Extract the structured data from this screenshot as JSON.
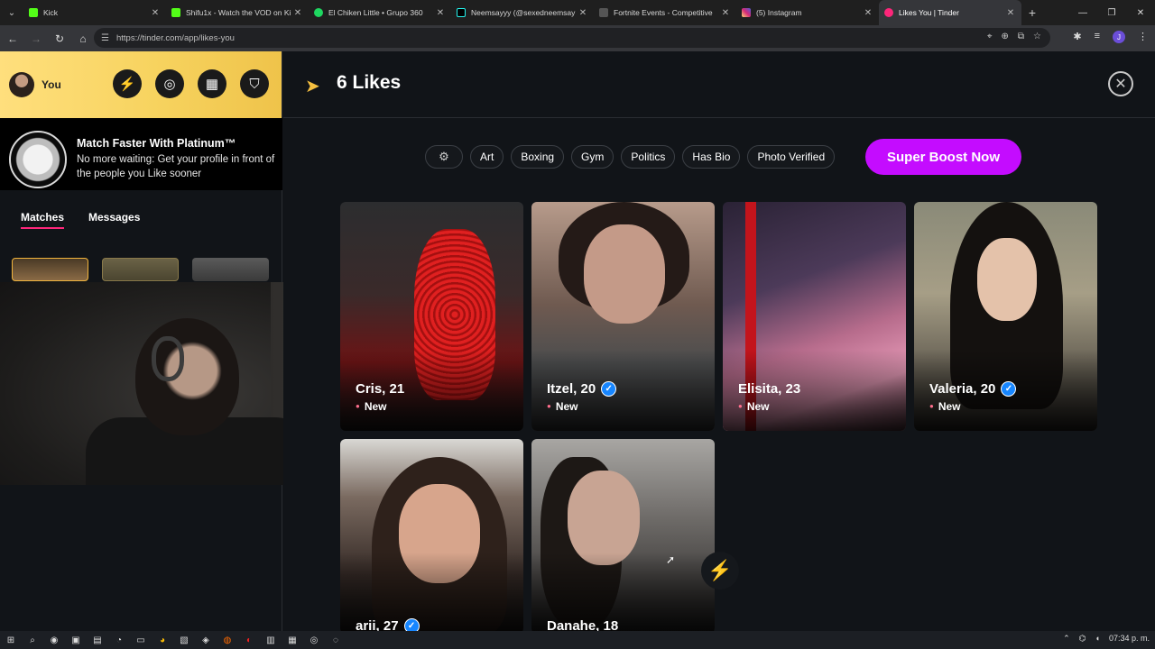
{
  "browser": {
    "tabs": [
      {
        "title": "Kick",
        "color": "#53fc18",
        "active": false
      },
      {
        "title": "Shifu1x - Watch the VOD on Ki",
        "color": "#53fc18",
        "active": false
      },
      {
        "title": "El Chiken Little • Grupo 360",
        "color": "#1ed760",
        "active": false
      },
      {
        "title": "Neemsayyy (@sexedneemsay",
        "color": "#000000",
        "active": false
      },
      {
        "title": "Fortnite Events - Competitive",
        "color": "#2b2b2b",
        "active": false
      },
      {
        "title": "(5) Instagram",
        "color": "#e1306c",
        "active": false
      },
      {
        "title": "Likes You | Tinder",
        "color": "#fd267a",
        "active": true
      }
    ],
    "url": "https://tinder.com/app/likes-you",
    "profile_initial": "J"
  },
  "sidebar": {
    "user_label": "You",
    "promo": {
      "title": "Match Faster With Platinum™",
      "text": "No more waiting: Get your profile in front of the people you Like sooner"
    },
    "tabs": {
      "matches": "Matches",
      "messages": "Messages"
    }
  },
  "main": {
    "likes_title": "6 Likes",
    "filters": [
      "Art",
      "Boxing",
      "Gym",
      "Politics",
      "Has Bio",
      "Photo Verified"
    ],
    "boost_button": "Super Boost Now",
    "profiles": [
      {
        "name": "Cris, 21",
        "verified": false,
        "status": "New"
      },
      {
        "name": "Itzel, 20",
        "verified": true,
        "status": "New"
      },
      {
        "name": "Elisita, 23",
        "verified": false,
        "status": "New"
      },
      {
        "name": "Valeria, 20",
        "verified": true,
        "status": "New"
      },
      {
        "name": "arii, 27",
        "verified": true,
        "status": ""
      },
      {
        "name": "Danahe, 18",
        "verified": false,
        "status": ""
      }
    ]
  },
  "taskbar": {
    "clock": "07:34 p. m."
  },
  "colors": {
    "brand": "#fd267a",
    "boost": "#c40cff",
    "gold": "#f7d35f"
  }
}
